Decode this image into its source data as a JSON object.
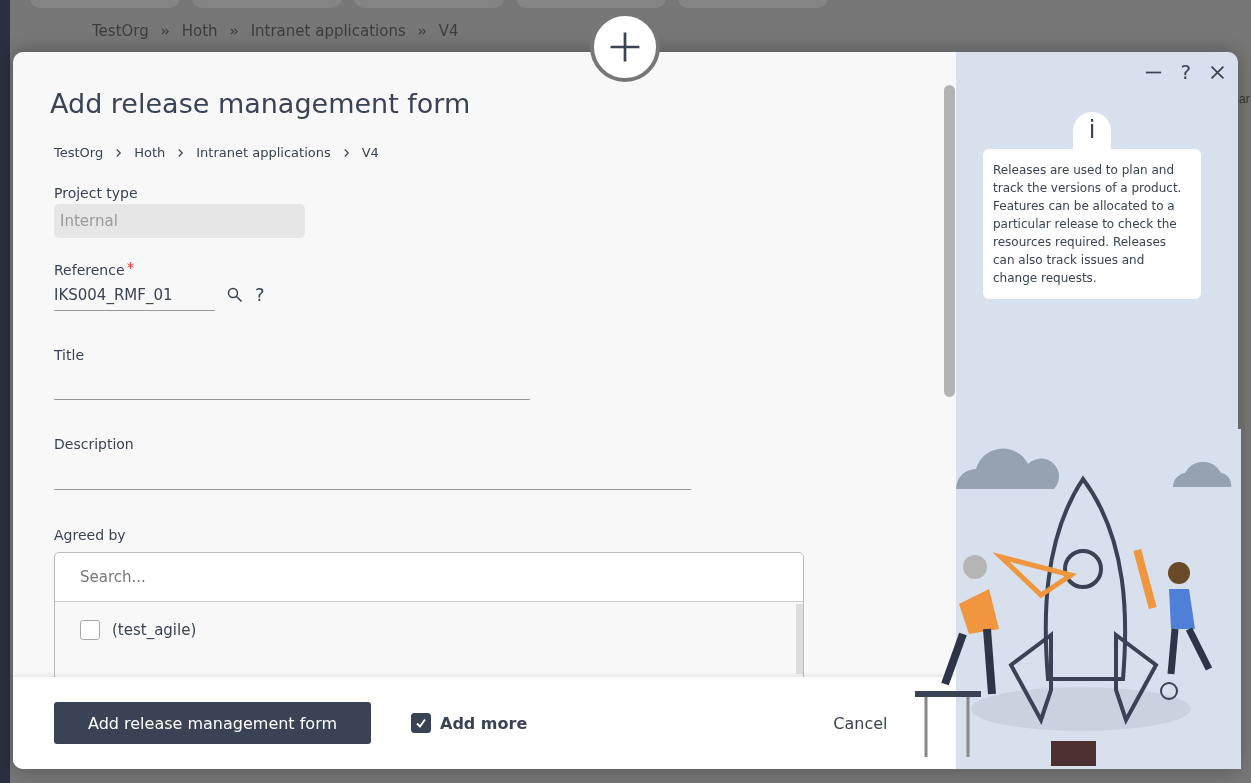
{
  "background": {
    "breadcrumb": [
      "TestOrg",
      "Hoth",
      "Intranet applications",
      "V4"
    ],
    "edge_text": "ar"
  },
  "dialog": {
    "title": "Add release management form",
    "breadcrumb": [
      "TestOrg",
      "Hoth",
      "Intranet applications",
      "V4"
    ],
    "fields": [
      {
        "kind": "readonly",
        "label": "Project type",
        "value": "Internal",
        "required": false
      },
      {
        "kind": "lookup",
        "label": "Reference",
        "value": "IKS004_RMF_01",
        "required": true,
        "help": "?"
      },
      {
        "kind": "text",
        "label": "Title",
        "required": false
      },
      {
        "kind": "text",
        "label": "Description",
        "required": false
      },
      {
        "kind": "multiselect",
        "label": "Agreed by",
        "placeholder": "Search...",
        "options": [
          {
            "label": "(test_agile)",
            "checked": false
          }
        ]
      }
    ],
    "footer": {
      "submit": "Add release management form",
      "add_more": {
        "label": "Add more",
        "checked": true
      },
      "cancel": "Cancel"
    },
    "window_controls": {
      "help": "?"
    },
    "info": {
      "icon": "i",
      "text": "Releases are used to plan and track the versions of a product. Features can be allocated to a particular release to check the resources required. Releases can also track issues and change requests."
    }
  }
}
